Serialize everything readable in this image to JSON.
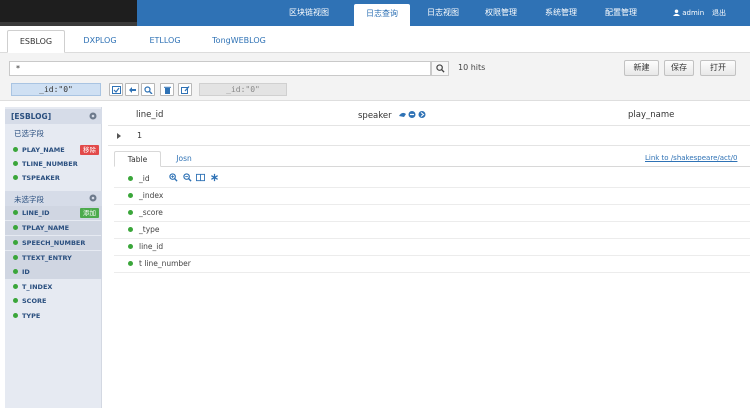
{
  "nav": {
    "items": [
      "区块链视图",
      "日志查询",
      "日志视图",
      "权限管理",
      "系统管理",
      "配置管理"
    ],
    "active_index": 1,
    "user": "admin",
    "logout": "退出"
  },
  "tabs": [
    "ESBLOG",
    "DXPLOG",
    "ETLLOG",
    "TongWEBLOG"
  ],
  "active_tab": "ESBLOG",
  "search": {
    "value": "*",
    "hits": "10 hits",
    "buttons": {
      "new": "新建",
      "save": "保存",
      "open": "打开"
    },
    "filter_active": "_id:\"0\"",
    "filter_disabled": "_id:\"0\""
  },
  "sidebar": {
    "index_name": "[ESBLOG]",
    "selected_title": "已选字段",
    "selected_fields": [
      {
        "name": "PLAY_NAME",
        "tag": "移除"
      },
      {
        "name": "TLINE_NUMBER",
        "tag": ""
      },
      {
        "name": "TSPEAKER",
        "tag": ""
      }
    ],
    "unselected_title": "未选字段",
    "unselected_fields": [
      {
        "name": "LINE_ID",
        "tag": "添加"
      },
      {
        "name": "TPLAY_NAME",
        "tag": ""
      },
      {
        "name": "SPEECH_NUMBER",
        "tag": ""
      },
      {
        "name": "TTEXT_ENTRY",
        "tag": ""
      },
      {
        "name": "ID",
        "tag": ""
      },
      {
        "name": "T_INDEX",
        "tag": ""
      },
      {
        "name": "SCORE",
        "tag": ""
      },
      {
        "name": "TYPE",
        "tag": ""
      }
    ]
  },
  "table": {
    "columns": [
      "line_id",
      "speaker",
      "play_name"
    ],
    "row_value": "1"
  },
  "doc": {
    "tabs": [
      "Table",
      "Josn"
    ],
    "link": "Link to /shakespeare/act/0",
    "fields": [
      "_id",
      "_index",
      "_score",
      "_type",
      "line_id",
      "t line_number"
    ]
  },
  "colors": {
    "nav_bg": "#2f72b5",
    "accent": "#2f72b5",
    "tag_remove": "#e24a4a",
    "tag_add": "#4caa4c",
    "field_dot": "#3aa63a"
  }
}
